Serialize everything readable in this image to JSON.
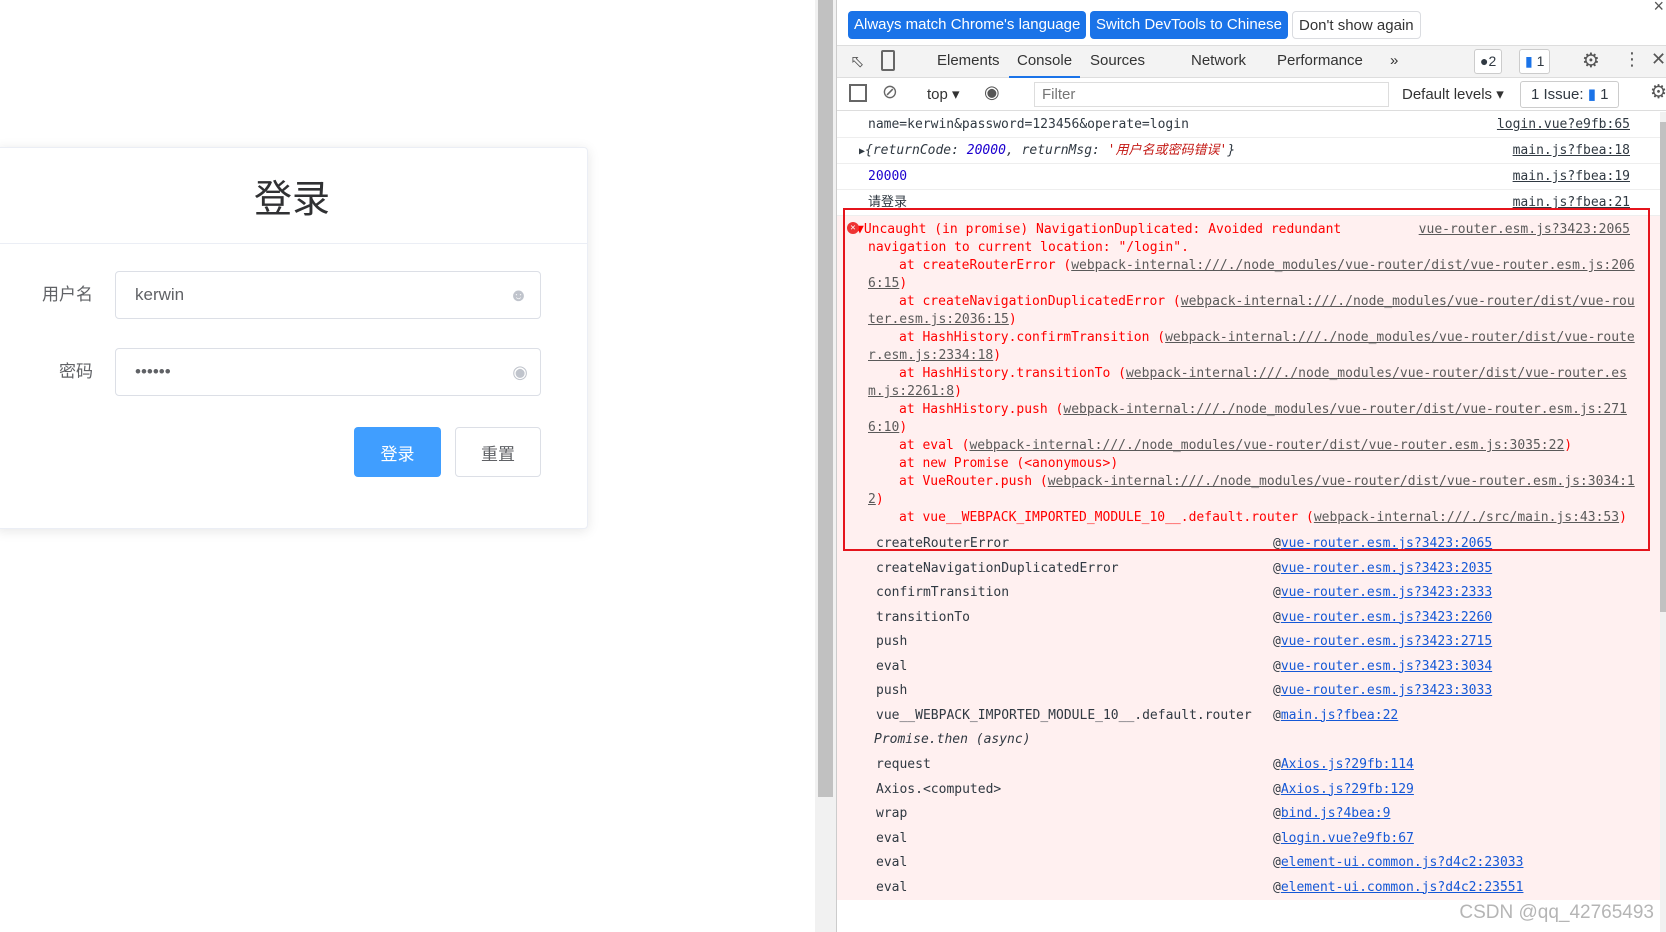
{
  "login": {
    "title": "登录",
    "username_label": "用户名",
    "username_value": "kerwin",
    "password_label": "密码",
    "password_value": "••••••",
    "login_button": "登录",
    "reset_button": "重置"
  },
  "devtools": {
    "banner": {
      "match_language": "Always match Chrome's language",
      "switch_chinese": "Switch DevTools to Chinese",
      "dont_show": "Don't show again",
      "close": "×"
    },
    "tabs": [
      "Elements",
      "Console",
      "Sources",
      "Network",
      "Performance"
    ],
    "more_tabs": "»",
    "active_tab": "Console",
    "error_count": "2",
    "message_count": "1",
    "toolbar": {
      "context": "top",
      "filter_placeholder": "Filter",
      "levels": "Default levels",
      "issues_label": "1 Issue:",
      "issues_count": "1"
    },
    "messages": [
      {
        "text": "name=kerwin&password=123456&operate=login",
        "source": "login.vue?e9fb:65"
      },
      {
        "text_prefix": "{returnCode: ",
        "code": "20000",
        "mid": ", returnMsg: ",
        "msg": "'用户名或密码错误'",
        "suffix": "}",
        "source": "main.js?fbea:18"
      },
      {
        "text": "20000",
        "source": "main.js?fbea:19"
      },
      {
        "text": "请登录",
        "source": "main.js?fbea:21"
      }
    ],
    "error": {
      "message": "Uncaught (in promise) NavigationDuplicated: Avoided redundant navigation to current location: \"/login\".",
      "source": "vue-router.esm.js?3423:2065",
      "stack": [
        {
          "at": "at createRouterError (",
          "link": "webpack-internal:///./node_modules/vue-router/dist/vue-router.esm.js:2066:15"
        },
        {
          "at": "at createNavigationDuplicatedError (",
          "link": "webpack-internal:///./node_modules/vue-router/dist/vue-router.esm.js:2036:15"
        },
        {
          "at": "at HashHistory.confirmTransition (",
          "link": "webpack-internal:///./node_modules/vue-router/dist/vue-router.esm.js:2334:18"
        },
        {
          "at": "at HashHistory.transitionTo (",
          "link": "webpack-internal:///./node_modules/vue-router/dist/vue-router.esm.js:2261:8"
        },
        {
          "at": "at HashHistory.push (",
          "link": "webpack-internal:///./node_modules/vue-router/dist/vue-router.esm.js:2716:10"
        },
        {
          "at": "at eval (",
          "link": "webpack-internal:///./node_modules/vue-router/dist/vue-router.esm.js:3035:22"
        },
        {
          "at": "at new Promise (<anonymous>",
          "link": ""
        },
        {
          "at": "at VueRouter.push (",
          "link": "webpack-internal:///./node_modules/vue-router/dist/vue-router.esm.js:3034:12"
        },
        {
          "at": "at vue__WEBPACK_IMPORTED_MODULE_10__.default.router (",
          "link": "webpack-internal:///./src/main.js:43:53"
        }
      ]
    },
    "trace": [
      {
        "fn": "createRouterError",
        "link": "vue-router.esm.js?3423:2065"
      },
      {
        "fn": "createNavigationDuplicatedError",
        "link": "vue-router.esm.js?3423:2035"
      },
      {
        "fn": "confirmTransition",
        "link": "vue-router.esm.js?3423:2333"
      },
      {
        "fn": "transitionTo",
        "link": "vue-router.esm.js?3423:2260"
      },
      {
        "fn": "push",
        "link": "vue-router.esm.js?3423:2715"
      },
      {
        "fn": "eval",
        "link": "vue-router.esm.js?3423:3034"
      },
      {
        "fn": "push",
        "link": "vue-router.esm.js?3423:3033"
      },
      {
        "fn": "vue__WEBPACK_IMPORTED_MODULE_10__.default.router",
        "link": "main.js?fbea:22"
      },
      {
        "fn": "Promise.then (async)",
        "link": "",
        "async": true
      },
      {
        "fn": "request",
        "link": "Axios.js?29fb:114"
      },
      {
        "fn": "Axios.<computed>",
        "link": "Axios.js?29fb:129"
      },
      {
        "fn": "wrap",
        "link": "bind.js?4bea:9"
      },
      {
        "fn": "eval",
        "link": "login.vue?e9fb:67"
      },
      {
        "fn": "eval",
        "link": "element-ui.common.js?d4c2:23033"
      },
      {
        "fn": "eval",
        "link": "element-ui.common.js?d4c2:23551"
      }
    ],
    "at_symbol": "@"
  },
  "watermark": "CSDN @qq_42765493"
}
